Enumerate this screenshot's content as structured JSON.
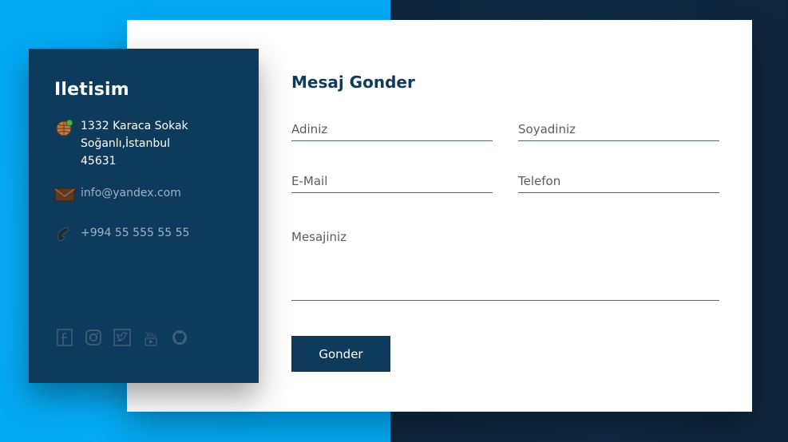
{
  "contact": {
    "title": "Iletisim",
    "address_lines": [
      "1332 Karaca Sokak",
      "Soğanlı,İstanbul",
      "45631"
    ],
    "email": "info@yandex.com",
    "phone": "+994 55 555 55 55",
    "social_icons": [
      "facebook-icon",
      "instagram-icon",
      "twitter-icon",
      "youtube-icon",
      "github-icon"
    ]
  },
  "form": {
    "title": "Mesaj Gonder",
    "first_name_placeholder": "Adiniz",
    "last_name_placeholder": "Soyadiniz",
    "email_placeholder": "E-Mail",
    "phone_placeholder": "Telefon",
    "message_placeholder": "Mesajiniz",
    "submit_label": "Gonder"
  },
  "colors": {
    "left_bg": "#03a9f4",
    "right_bg": "#0f2a44",
    "card_dark": "#0e3a5b"
  }
}
